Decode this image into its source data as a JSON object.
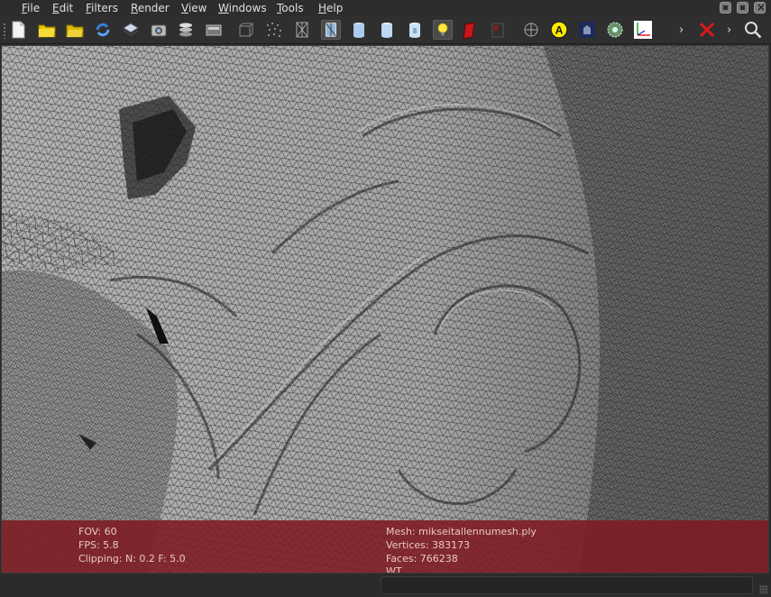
{
  "menu": [
    {
      "label": "File",
      "mnemonic": "F",
      "rest": "ile"
    },
    {
      "label": "Edit",
      "mnemonic": "E",
      "rest": "dit"
    },
    {
      "label": "Filters",
      "mnemonic": "F",
      "rest": "ilters"
    },
    {
      "label": "Render",
      "mnemonic": "R",
      "rest": "ender"
    },
    {
      "label": "View",
      "mnemonic": "V",
      "rest": "iew"
    },
    {
      "label": "Windows",
      "mnemonic": "W",
      "rest": "indows"
    },
    {
      "label": "Tools",
      "mnemonic": "T",
      "rest": "ools"
    },
    {
      "label": "Help",
      "mnemonic": "H",
      "rest": "elp"
    }
  ],
  "toolbar": {
    "buttons": [
      {
        "name": "new-project-icon"
      },
      {
        "name": "open-project-icon"
      },
      {
        "name": "open-mesh-icon"
      },
      {
        "name": "reload-icon"
      },
      {
        "name": "save-icon"
      },
      {
        "name": "snapshot-icon"
      },
      {
        "name": "layers-icon"
      },
      {
        "name": "raster-icon"
      },
      {
        "name": "bounding-box-icon"
      },
      {
        "name": "points-icon"
      },
      {
        "name": "wireframe-icon"
      },
      {
        "name": "flat-lines-icon",
        "active": true
      },
      {
        "name": "flat-icon"
      },
      {
        "name": "smooth-icon"
      },
      {
        "name": "texture-icon"
      },
      {
        "name": "light-icon",
        "active": true
      },
      {
        "name": "backface-icon"
      },
      {
        "name": "selected-faces-icon"
      },
      {
        "name": "measure-icon"
      },
      {
        "name": "annotation-icon"
      },
      {
        "name": "texture-param-icon"
      },
      {
        "name": "colorize-icon"
      },
      {
        "name": "axes-icon"
      },
      {
        "name": "delete-selection-icon"
      },
      {
        "name": "search-icon"
      }
    ],
    "overflow_glyph": "›"
  },
  "info": {
    "fov": "FOV: 60",
    "fps": "FPS:     5.8",
    "clipping": "Clipping: N:    0.2 F:    5.0",
    "mesh": "Mesh: mikseitallennumesh.ply",
    "vertices": "Vertices: 383173",
    "faces": "Faces: 766238",
    "wt": "WT"
  },
  "colors": {
    "overlay": "#7e1a22",
    "mesh_fill": "#a9a9a9",
    "mesh_lines": "#2a2a2a"
  }
}
